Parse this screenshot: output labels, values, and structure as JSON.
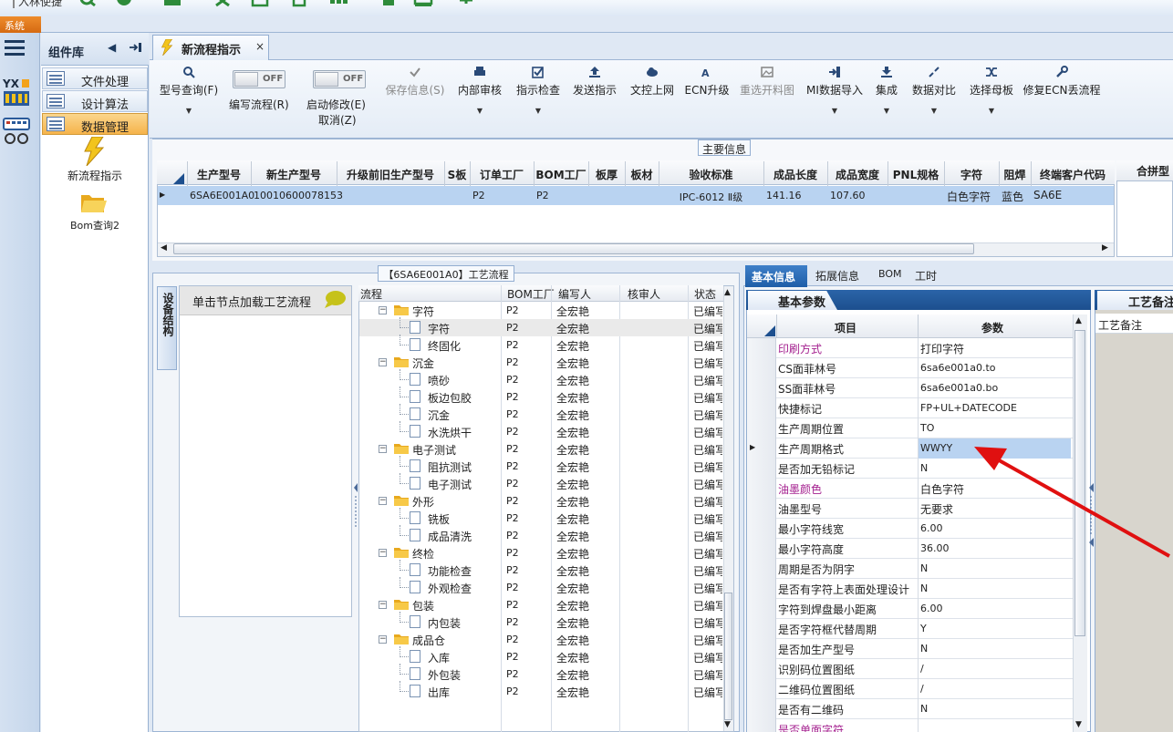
{
  "topbar": {
    "quick_label": "入林使捷",
    "system_tab": "系统"
  },
  "library": {
    "title": "组件库",
    "items": [
      {
        "label": "文件处理",
        "selected": false
      },
      {
        "label": "设计算法",
        "selected": false
      },
      {
        "label": "数据管理",
        "selected": true
      }
    ],
    "icons": [
      {
        "label": "新流程指示",
        "icon": "lightning-icon"
      },
      {
        "label": "Bom查询2",
        "icon": "folder-open-icon"
      }
    ]
  },
  "doc_tab": {
    "title": "新流程指示",
    "close": "×"
  },
  "toolbar": {
    "buttons": [
      {
        "label": "型号查询(F)",
        "icon": "search-icon",
        "dropdown": true,
        "disabled": false
      },
      {
        "label": "保存信息(S)",
        "icon": "check-icon",
        "dropdown": false,
        "disabled": true
      },
      {
        "label": "内部审核",
        "icon": "print-icon",
        "dropdown": true,
        "disabled": false
      },
      {
        "label": "指示检查",
        "icon": "checkbox-icon",
        "dropdown": true,
        "disabled": false
      },
      {
        "label": "发送指示",
        "icon": "upload-icon",
        "dropdown": false,
        "disabled": false
      },
      {
        "label": "文控上网",
        "icon": "cloud-upload-icon",
        "dropdown": false,
        "disabled": false
      },
      {
        "label": "ECN升级",
        "icon": "ecn-icon",
        "dropdown": false,
        "disabled": false
      },
      {
        "label": "重选开料图",
        "icon": "image-icon",
        "dropdown": false,
        "disabled": true
      },
      {
        "label": "MI数据导入",
        "icon": "import-icon",
        "dropdown": true,
        "disabled": false
      },
      {
        "label": "集成",
        "icon": "download-icon",
        "dropdown": true,
        "disabled": false
      },
      {
        "label": "数据对比",
        "icon": "compress-icon",
        "dropdown": true,
        "disabled": false
      },
      {
        "label": "选择母板",
        "icon": "shuffle-icon",
        "dropdown": true,
        "disabled": false
      },
      {
        "label": "修复ECN丢流程",
        "icon": "wrench-icon",
        "dropdown": false,
        "disabled": false
      }
    ],
    "toggles": [
      {
        "label": "编写流程(R)",
        "state": "OFF"
      },
      {
        "label": "启动修改(E)",
        "state": "OFF",
        "sub": "取消(Z)"
      }
    ]
  },
  "main_info": {
    "legend": "主要信息",
    "columns": [
      "生产型号",
      "新生产型号",
      "升级前旧生产型号",
      "S板",
      "订单工厂",
      "BOM工厂",
      "板厚",
      "板材",
      "验收标准",
      "成品长度",
      "成品宽度",
      "PNL规格",
      "字符",
      "阻焊",
      "终端客户代码"
    ],
    "row": [
      "6SA6E001A0",
      "10010600078153",
      "",
      "",
      "P2",
      "P2",
      "",
      "",
      "IPC-6012 Ⅱ级",
      "141.16",
      "107.60",
      "",
      "白色字符",
      "蓝色",
      "SA6E"
    ],
    "right_header": "合拼型"
  },
  "flow": {
    "legend": "【6SA6E001A0】工艺流程",
    "vtab": "设备结构",
    "hint": "单击节点加载工艺流程",
    "columns": [
      "流程",
      "BOM工厂",
      "编写人",
      "核审人",
      "状态"
    ],
    "rows": [
      {
        "name": "字符",
        "folder": true,
        "bom": "P2",
        "writer": "全宏艳",
        "reviewer": "",
        "status": "已编写"
      },
      {
        "name": "字符",
        "folder": false,
        "bom": "P2",
        "writer": "全宏艳",
        "reviewer": "",
        "status": "已编写",
        "selected": true
      },
      {
        "name": "终固化",
        "folder": false,
        "bom": "P2",
        "writer": "全宏艳",
        "reviewer": "",
        "status": "已编写"
      },
      {
        "name": "沉金",
        "folder": true,
        "bom": "P2",
        "writer": "全宏艳",
        "reviewer": "",
        "status": "已编写"
      },
      {
        "name": "喷砂",
        "folder": false,
        "bom": "P2",
        "writer": "全宏艳",
        "reviewer": "",
        "status": "已编写"
      },
      {
        "name": "板边包胶",
        "folder": false,
        "bom": "P2",
        "writer": "全宏艳",
        "reviewer": "",
        "status": "已编写"
      },
      {
        "name": "沉金",
        "folder": false,
        "bom": "P2",
        "writer": "全宏艳",
        "reviewer": "",
        "status": "已编写"
      },
      {
        "name": "水洗烘干",
        "folder": false,
        "bom": "P2",
        "writer": "全宏艳",
        "reviewer": "",
        "status": "已编写"
      },
      {
        "name": "电子测试",
        "folder": true,
        "bom": "P2",
        "writer": "全宏艳",
        "reviewer": "",
        "status": "已编写"
      },
      {
        "name": "阻抗测试",
        "folder": false,
        "bom": "P2",
        "writer": "全宏艳",
        "reviewer": "",
        "status": "已编写"
      },
      {
        "name": "电子测试",
        "folder": false,
        "bom": "P2",
        "writer": "全宏艳",
        "reviewer": "",
        "status": "已编写"
      },
      {
        "name": "外形",
        "folder": true,
        "bom": "P2",
        "writer": "全宏艳",
        "reviewer": "",
        "status": "已编写"
      },
      {
        "name": "铣板",
        "folder": false,
        "bom": "P2",
        "writer": "全宏艳",
        "reviewer": "",
        "status": "已编写"
      },
      {
        "name": "成品清洗",
        "folder": false,
        "bom": "P2",
        "writer": "全宏艳",
        "reviewer": "",
        "status": "已编写"
      },
      {
        "name": "终检",
        "folder": true,
        "bom": "P2",
        "writer": "全宏艳",
        "reviewer": "",
        "status": "已编写"
      },
      {
        "name": "功能检查",
        "folder": false,
        "bom": "P2",
        "writer": "全宏艳",
        "reviewer": "",
        "status": "已编写"
      },
      {
        "name": "外观检查",
        "folder": false,
        "bom": "P2",
        "writer": "全宏艳",
        "reviewer": "",
        "status": "已编写"
      },
      {
        "name": "包装",
        "folder": true,
        "bom": "P2",
        "writer": "全宏艳",
        "reviewer": "",
        "status": "已编写"
      },
      {
        "name": "内包装",
        "folder": false,
        "bom": "P2",
        "writer": "全宏艳",
        "reviewer": "",
        "status": "已编写"
      },
      {
        "name": "成品仓",
        "folder": true,
        "bom": "P2",
        "writer": "全宏艳",
        "reviewer": "",
        "status": "已编写"
      },
      {
        "name": "入库",
        "folder": false,
        "bom": "P2",
        "writer": "全宏艳",
        "reviewer": "",
        "status": "已编写"
      },
      {
        "name": "外包装",
        "folder": false,
        "bom": "P2",
        "writer": "全宏艳",
        "reviewer": "",
        "status": "已编写"
      },
      {
        "name": "出库",
        "folder": false,
        "bom": "P2",
        "writer": "全宏艳",
        "reviewer": "",
        "status": "已编写"
      }
    ]
  },
  "right": {
    "tabs": [
      "基本信息",
      "拓展信息",
      "BOM",
      "工时"
    ],
    "basic_title": "基本参数",
    "columns": [
      "项目",
      "参数"
    ],
    "params": [
      {
        "key": "印刷方式",
        "value": "打印字符",
        "highlight": true,
        "big": true
      },
      {
        "key": "CS面菲林号",
        "value": "6sa6e001a0.to"
      },
      {
        "key": "SS面菲林号",
        "value": "6sa6e001a0.bo"
      },
      {
        "key": "快捷标记",
        "value": "FP+UL+DATECODE"
      },
      {
        "key": "生产周期位置",
        "value": "TO"
      },
      {
        "key": "生产周期格式",
        "value": "WWYY",
        "selected": true
      },
      {
        "key": "是否加无铅标记",
        "value": "N"
      },
      {
        "key": "油墨颜色",
        "value": "白色字符",
        "highlight": true,
        "big": true
      },
      {
        "key": "油墨型号",
        "value": "无要求",
        "big": true
      },
      {
        "key": "最小字符线宽",
        "value": "6.00"
      },
      {
        "key": "最小字符高度",
        "value": "36.00"
      },
      {
        "key": "周期是否为阴字",
        "value": "N"
      },
      {
        "key": "是否有字符上表面处理设计",
        "value": "N"
      },
      {
        "key": "字符到焊盘最小距离",
        "value": "6.00"
      },
      {
        "key": "是否字符框代替周期",
        "value": "Y"
      },
      {
        "key": "是否加生产型号",
        "value": "N"
      },
      {
        "key": "识别码位置图纸",
        "value": "/"
      },
      {
        "key": "二维码位置图纸",
        "value": "/"
      },
      {
        "key": "是否有二维码",
        "value": "N"
      },
      {
        "key": "是否单面字符",
        "value": "",
        "highlight": true
      }
    ],
    "craft_title": "工艺备注",
    "craft_sub": "工艺备注"
  },
  "colors": {
    "accent": "#1f5ea8",
    "selected_row": "#b9d3f1",
    "highlight_text": "#a4208f",
    "arrow": "#e01010"
  }
}
